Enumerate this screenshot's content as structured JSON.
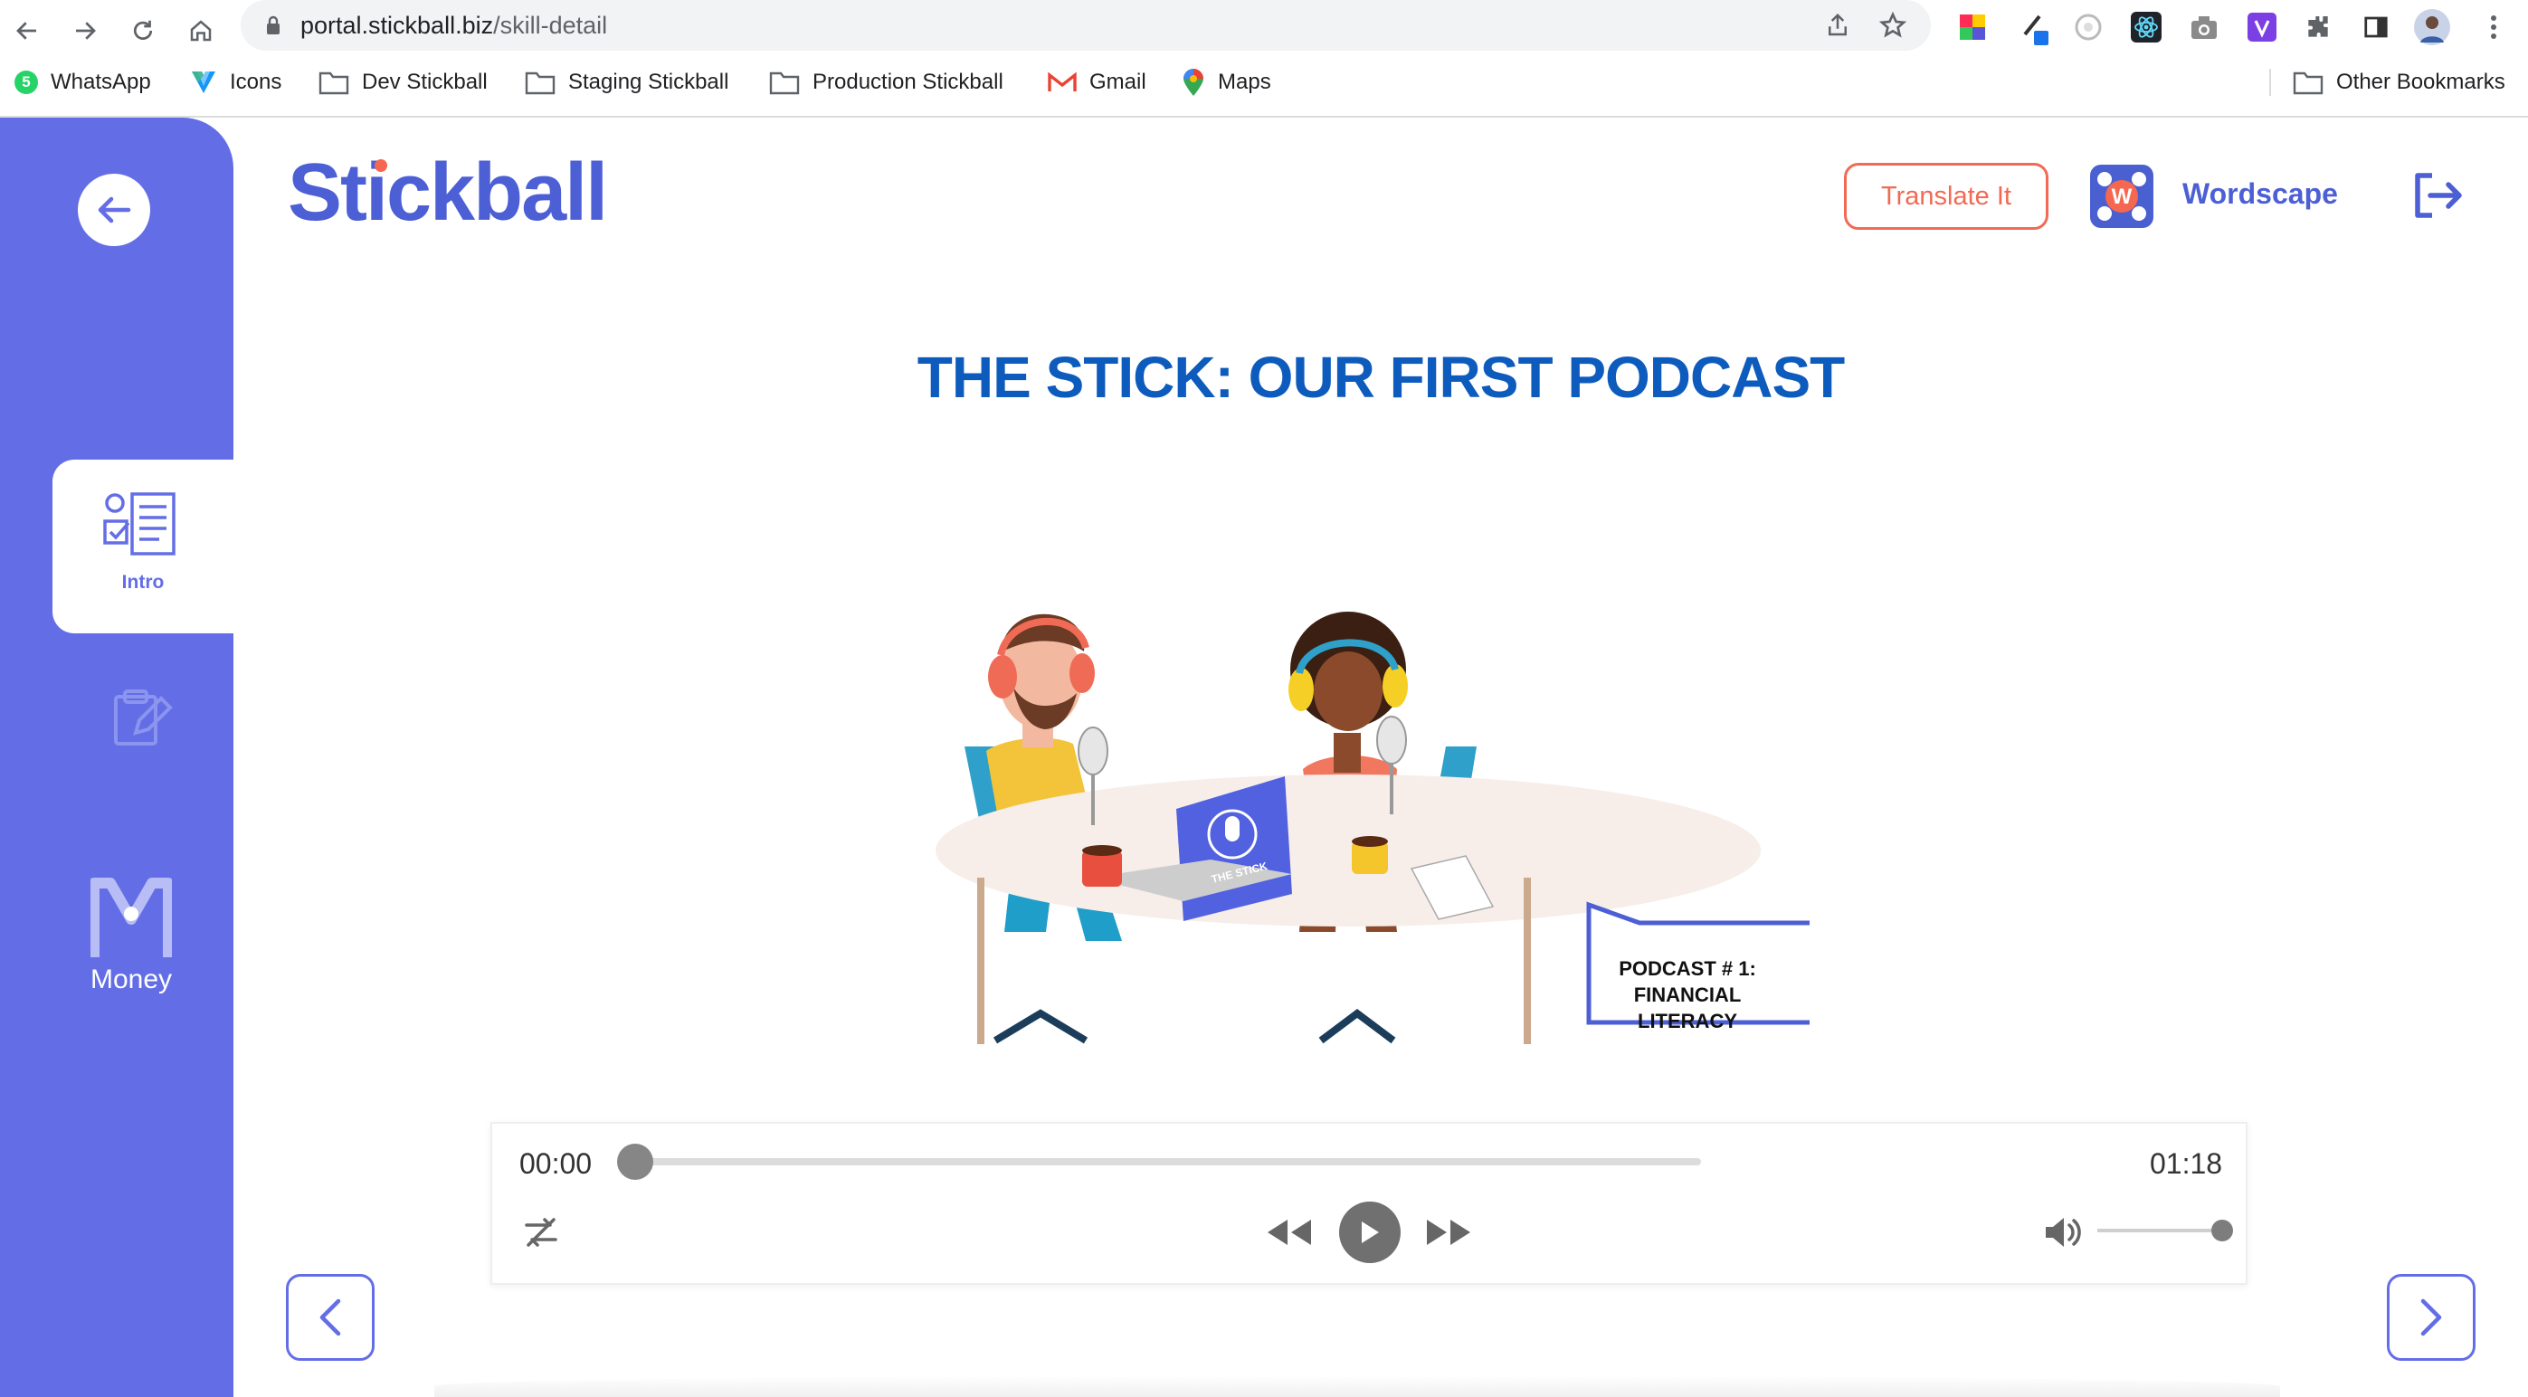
{
  "browser": {
    "url_host": "portal.stickball.biz",
    "url_path": "/skill-detail",
    "whatsapp_badge": "5",
    "bookmarks": [
      "WhatsApp",
      "Icons",
      "Dev Stickball",
      "Staging Stickball",
      "Production Stickball",
      "Gmail",
      "Maps"
    ],
    "other_bookmarks": "Other Bookmarks"
  },
  "sidebar": {
    "intro_label": "Intro",
    "money_label": "Money"
  },
  "header": {
    "logo_text": "Stickball",
    "translate_label": "Translate It",
    "wordscape_label": "Wordscape"
  },
  "main": {
    "title": "THE STICK: OUR FIRST PODCAST",
    "callout_line1": "PODCAST # 1:",
    "callout_line2": "FINANCIAL",
    "callout_line3": "LITERACY",
    "laptop_text": "THE STICK"
  },
  "player": {
    "current_time": "00:00",
    "duration": "01:18",
    "progress": 0,
    "volume": 1
  },
  "colors": {
    "brand": "#636ee6",
    "title": "#0d5bbd",
    "accent": "#f16a54"
  }
}
